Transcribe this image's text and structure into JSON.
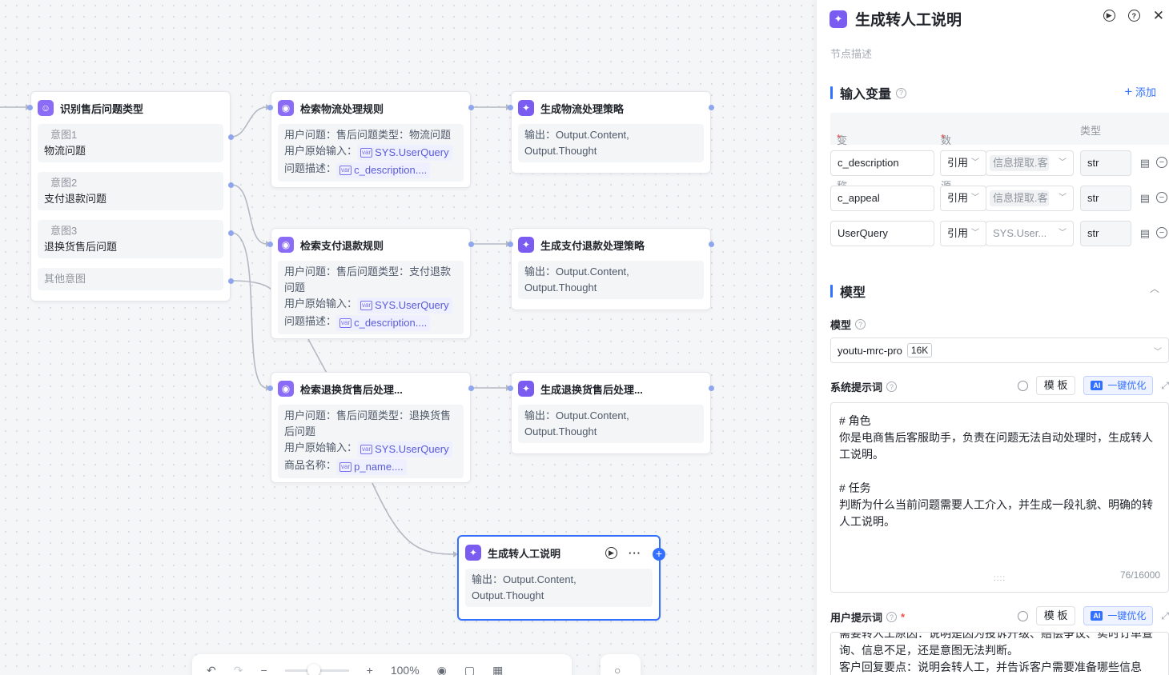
{
  "canvas": {
    "nodes": {
      "classify": {
        "title": "识别售后问题类型",
        "intents": [
          {
            "label": "意图1",
            "value": "物流问题"
          },
          {
            "label": "意图2",
            "value": "支付退款问题"
          },
          {
            "label": "意图3",
            "value": "退换货售后问题"
          }
        ],
        "other": "其他意图"
      },
      "search_logistics": {
        "title": "检索物流处理规则",
        "line1": "用户问题：售后问题类型：物流问题",
        "line2_label": "用户原始输入：",
        "line2_var": "SYS.UserQuery",
        "line3_label": "问题描述：",
        "line3_var": "c_description...."
      },
      "search_payment": {
        "title": "检索支付退款规则",
        "line1": "用户问题：售后问题类型：支付退款问题",
        "line2_label": "用户原始输入：",
        "line2_var": "SYS.UserQuery",
        "line3_label": "问题描述：",
        "line3_var": "c_description...."
      },
      "search_return": {
        "title": "检索退换货售后处理...",
        "line1": "用户问题：售后问题类型：退换货售后问题",
        "line2_label": "用户原始输入：",
        "line2_var": "SYS.UserQuery",
        "line3_label": "商品名称：",
        "line3_var": "p_name...."
      },
      "gen_logistics": {
        "title": "生成物流处理策略",
        "output": "输出：Output.Content, Output.Thought"
      },
      "gen_payment": {
        "title": "生成支付退款处理策略",
        "output": "输出：Output.Content, Output.Thought"
      },
      "gen_return": {
        "title": "生成退换货售后处理...",
        "output": "输出：Output.Content, Output.Thought"
      },
      "gen_handoff": {
        "title": "生成转人工说明",
        "output": "输出：Output.Content, Output.Thought"
      }
    },
    "toolbar": {
      "zoom": "100%"
    }
  },
  "panel": {
    "title": "生成转人工说明",
    "description_placeholder": "节点描述",
    "input_section": {
      "title": "输入变量",
      "add_label": "添加",
      "col_name": "变量名称",
      "col_source": "数据来源",
      "col_type": "类型",
      "rows": [
        {
          "name": "c_description",
          "mode": "引用",
          "source": "信息提取.客",
          "type": "str"
        },
        {
          "name": "c_appeal",
          "mode": "引用",
          "source": "信息提取.客",
          "type": "str"
        },
        {
          "name": "UserQuery",
          "mode": "引用",
          "source": "SYS.User...",
          "type": "str"
        }
      ]
    },
    "model_section": {
      "title": "模型",
      "model_label": "模型",
      "model_name": "youtu-mrc-pro",
      "model_tag": "16K"
    },
    "system_prompt": {
      "label": "系统提示词",
      "template_btn": "模 板",
      "optimize_btn": "一键优化",
      "ai_badge": "AI",
      "lines": [
        "# 角色",
        "你是电商售后客服助手，负责在问题无法自动处理时，生成转人",
        "工说明。",
        "",
        "# 任务",
        "判断为什么当前问题需要人工介入，并生成一段礼貌、明确的转",
        "人工说明。"
      ],
      "counter": "76/16000"
    },
    "user_prompt": {
      "label": "用户提示词",
      "template_btn": "模 板",
      "optimize_btn": "一键优化",
      "ai_badge": "AI",
      "lines": [
        "需要转人工原因：说明是因为投诉升级、赔偿争议、实时订单查",
        "询、信息不足，还是意图无法判断。",
        "客户回复要点：说明会转人工，并告诉客户需要准备哪些信息"
      ]
    }
  }
}
